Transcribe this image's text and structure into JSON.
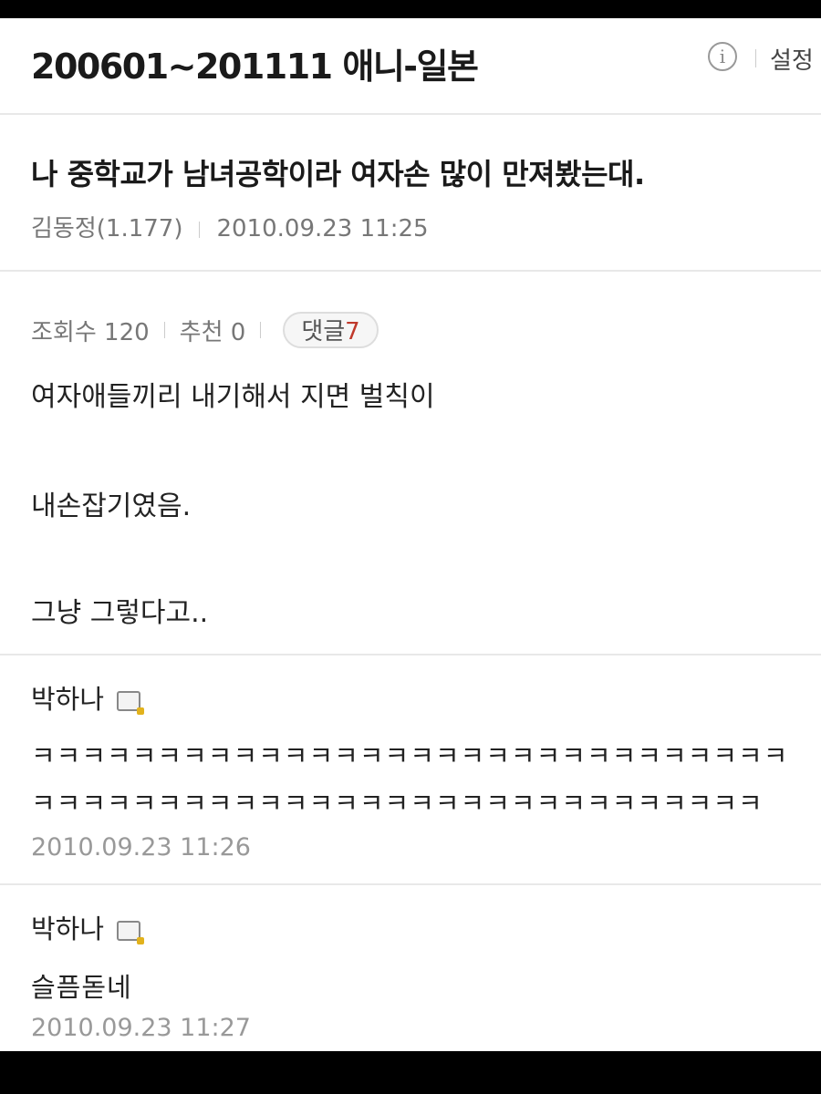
{
  "header": {
    "board_title": "200601~201111 애니-일본",
    "info_icon": "i",
    "settings_label": "설정"
  },
  "post": {
    "title": "나 중학교가 남녀공학이라 여자손 많이 만져봤는대.",
    "author": "김동정(1.177)",
    "datetime": "2010.09.23 11:25",
    "views_label": "조회수 120",
    "likes_label": "추천 0",
    "comments_label": "댓글",
    "comments_count": "7",
    "body_lines": [
      "여자애들끼리 내기해서 지면 벌칙이",
      "내손잡기였음.",
      "그냥 그렇다고.."
    ]
  },
  "comments": [
    {
      "author": "박하나",
      "icon": "memo-icon",
      "lines": [
        "ㅋㅋㅋㅋㅋㅋㅋㅋㅋㅋㅋㅋㅋㅋㅋㅋㅋㅋㅋㅋㅋㅋㅋㅋㅋㅋㅋㅋㅋㅋ",
        "ㅋㅋㅋㅋㅋㅋㅋㅋㅋㅋㅋㅋㅋㅋㅋㅋㅋㅋㅋㅋㅋㅋㅋㅋㅋㅋㅋㅋㅋ"
      ],
      "datetime": "2010.09.23 11:26"
    },
    {
      "author": "박하나",
      "icon": "memo-icon",
      "lines": [
        "슬픔돋네"
      ],
      "datetime": "2010.09.23 11:27"
    }
  ],
  "colors": {
    "accent_count": "#c0392b",
    "meta_text": "#777777",
    "divider": "#e8e8e8"
  }
}
